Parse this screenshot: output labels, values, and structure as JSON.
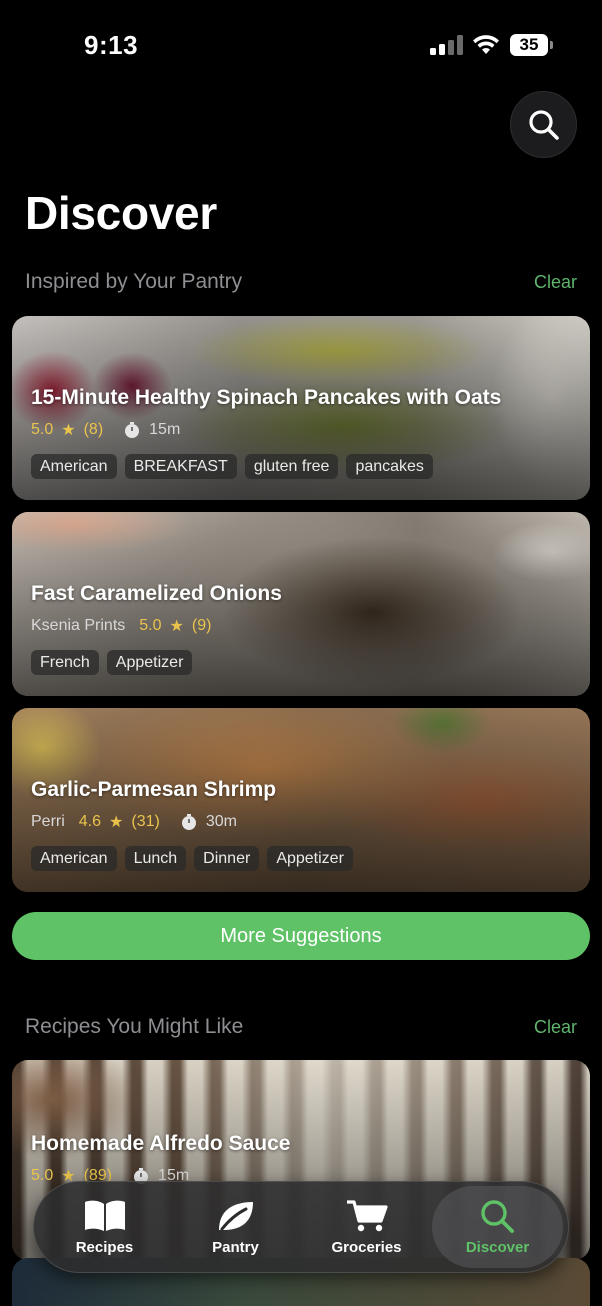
{
  "status_bar": {
    "time": "9:13",
    "battery": "35"
  },
  "header": {
    "title": "Discover"
  },
  "pantry_section": {
    "title": "Inspired by Your Pantry",
    "clear_label": "Clear",
    "recipes": [
      {
        "title": "15-Minute Healthy Spinach Pancakes with Oats",
        "author": "",
        "rating": "5.0",
        "reviews": "(8)",
        "time": "15m",
        "tags": [
          "American",
          "BREAKFAST",
          "gluten free",
          "pancakes"
        ]
      },
      {
        "title": "Fast Caramelized Onions",
        "author": "Ksenia Prints",
        "rating": "5.0",
        "reviews": "(9)",
        "time": "",
        "tags": [
          "French",
          "Appetizer"
        ]
      },
      {
        "title": "Garlic-Parmesan Shrimp",
        "author": "Perri",
        "rating": "4.6",
        "reviews": "(31)",
        "time": "30m",
        "tags": [
          "American",
          "Lunch",
          "Dinner",
          "Appetizer"
        ]
      }
    ],
    "more_button": "More Suggestions"
  },
  "like_section": {
    "title": "Recipes You Might Like",
    "clear_label": "Clear",
    "recipes": [
      {
        "title": "Homemade Alfredo Sauce",
        "rating": "5.0",
        "reviews": "(89)",
        "time": "15m"
      }
    ]
  },
  "tabbar": {
    "tabs": [
      {
        "label": "Recipes",
        "icon": "book-icon",
        "active": false
      },
      {
        "label": "Pantry",
        "icon": "leaf-icon",
        "active": false
      },
      {
        "label": "Groceries",
        "icon": "cart-icon",
        "active": false
      },
      {
        "label": "Discover",
        "icon": "search-icon",
        "active": true
      }
    ]
  },
  "colors": {
    "accent": "#5fc267",
    "rating": "#e9c34c",
    "background": "#000000"
  }
}
